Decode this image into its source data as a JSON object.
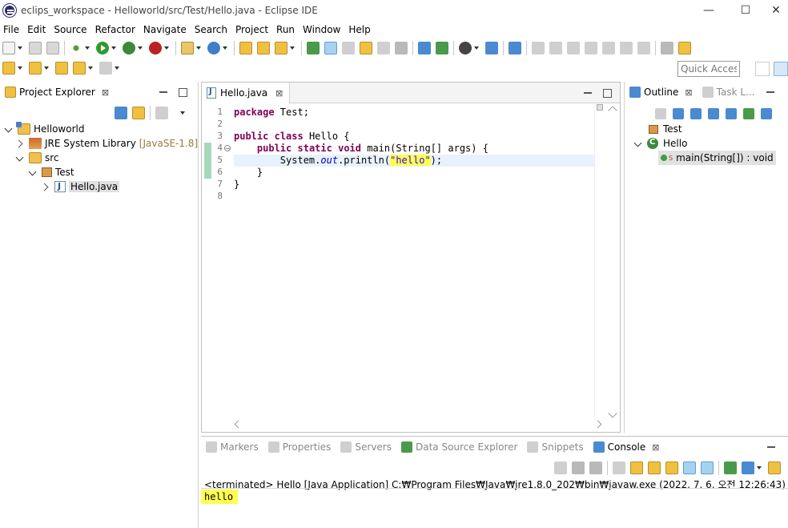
{
  "window": {
    "title": "eclips_workspace - Helloworld/src/Test/Hello.java - Eclipse IDE",
    "minimize": "—",
    "maximize": "☐",
    "close": "✕"
  },
  "menu": [
    "File",
    "Edit",
    "Source",
    "Refactor",
    "Navigate",
    "Search",
    "Project",
    "Run",
    "Window",
    "Help"
  ],
  "toolbar": {
    "quick_access_placeholder": "Quick Access"
  },
  "project_explorer": {
    "tab_label": "Project Explorer",
    "close": "⊠",
    "tree": [
      {
        "label": "Helloworld",
        "suffix": ""
      },
      {
        "label": "JRE System Library",
        "suffix": "[JavaSE-1.8]"
      },
      {
        "label": "src",
        "suffix": ""
      },
      {
        "label": "Test",
        "suffix": ""
      },
      {
        "label": "Hello.java",
        "suffix": ""
      }
    ]
  },
  "editor": {
    "tab_label": "Hello.java",
    "close": "⊠",
    "lines": [
      "1",
      "2",
      "3",
      "4",
      "5",
      "6",
      "7",
      "8"
    ],
    "code": {
      "l1_kw": "package",
      "l1_rest": " Test;",
      "l3_kw1": "public",
      "l3_kw2": "class",
      "l3_rest": " Hello {",
      "l4_indent": "    ",
      "l4_kw1": "public",
      "l4_kw2": "static",
      "l4_kw3": "void",
      "l4_rest": " main(String[] args) {",
      "l5_indent": "        System.",
      "l5_out": "out",
      "l5_mid": ".println(",
      "l5_str": "\"hello\"",
      "l5_end": ");",
      "l6": "    }",
      "l7": "}"
    }
  },
  "outline": {
    "tab_label": "Outline",
    "close": "⊠",
    "tab2_label": "Task L...",
    "items": [
      {
        "label": "Test"
      },
      {
        "label": "Hello"
      },
      {
        "label": "main(String[]) : void",
        "modifier": "S"
      }
    ]
  },
  "bottom_panel": {
    "tabs": [
      "Markers",
      "Properties",
      "Servers",
      "Data Source Explorer",
      "Snippets",
      "Console"
    ],
    "console_close": "⊠",
    "terminated": "<terminated> Hello [Java Application] C:₩Program Files₩Java₩jre1.8.0_202₩bin₩javaw.exe (2022. 7. 6. 오전 12:26:43)",
    "output": "hello"
  }
}
